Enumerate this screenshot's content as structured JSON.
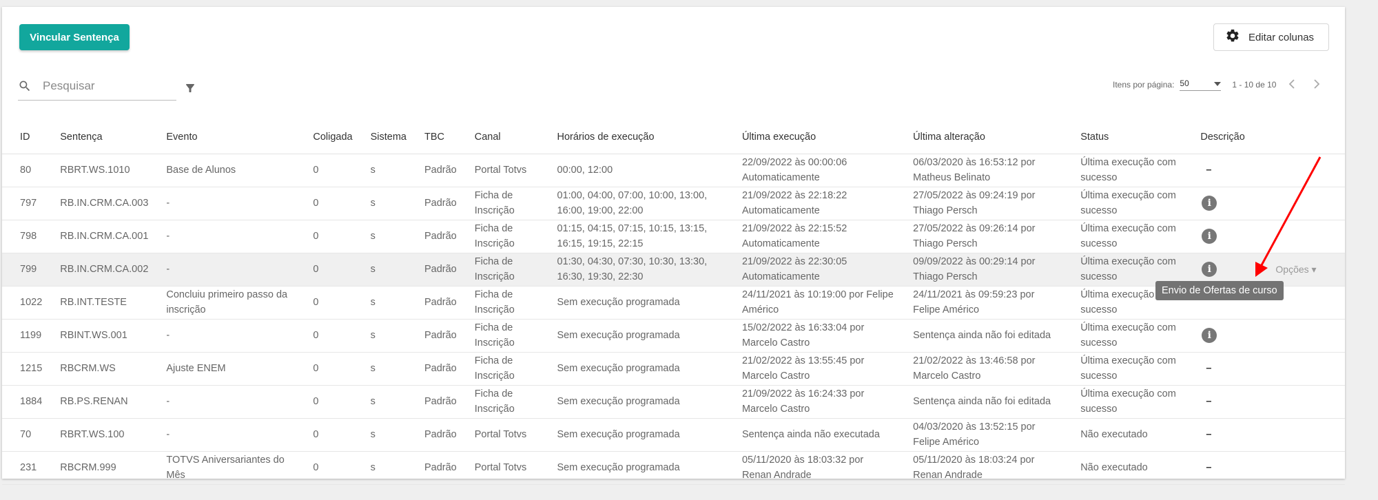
{
  "toolbar": {
    "primary_label": "Vincular Sentença",
    "columns_label": "Editar colunas"
  },
  "search": {
    "placeholder": "Pesquisar"
  },
  "pager": {
    "items_label": "Itens por página:",
    "items_value": "50",
    "range": "1 - 10 de 10"
  },
  "columns": [
    "ID",
    "Sentença",
    "Evento",
    "Coligada",
    "Sistema",
    "TBC",
    "Canal",
    "Horários de execução",
    "Última execução",
    "Última alteração",
    "Status",
    "Descrição"
  ],
  "rows": [
    {
      "id": "80",
      "sentenca": "RBRT.WS.1010",
      "evento": "Base de Alunos",
      "coligada": "0",
      "sistema": "s",
      "tbc": "Padrão",
      "canal": "Portal Totvs",
      "horarios": "00:00, 12:00",
      "ultima_execucao": "22/09/2022 às 00:00:06 Automaticamente",
      "ultima_alteracao": "06/03/2020 às 16:53:12 por Matheus Belinato",
      "status": "Última execução com sucesso",
      "descricao": "–"
    },
    {
      "id": "797",
      "sentenca": "RB.IN.CRM.CA.003",
      "evento": "-",
      "coligada": "0",
      "sistema": "s",
      "tbc": "Padrão",
      "canal": "Ficha de Inscrição",
      "horarios": "01:00, 04:00, 07:00, 10:00, 13:00, 16:00, 19:00, 22:00",
      "ultima_execucao": "21/09/2022 às 22:18:22 Automaticamente",
      "ultima_alteracao": "27/05/2022 às 09:24:19 por Thiago Persch",
      "status": "Última execução com sucesso",
      "descricao": "i"
    },
    {
      "id": "798",
      "sentenca": "RB.IN.CRM.CA.001",
      "evento": "-",
      "coligada": "0",
      "sistema": "s",
      "tbc": "Padrão",
      "canal": "Ficha de Inscrição",
      "horarios": "01:15, 04:15, 07:15, 10:15, 13:15, 16:15, 19:15, 22:15",
      "ultima_execucao": "21/09/2022 às 22:15:52 Automaticamente",
      "ultima_alteracao": "27/05/2022 às 09:26:14 por Thiago Persch",
      "status": "Última execução com sucesso",
      "descricao": "i"
    },
    {
      "id": "799",
      "sentenca": "RB.IN.CRM.CA.002",
      "evento": "-",
      "coligada": "0",
      "sistema": "s",
      "tbc": "Padrão",
      "canal": "Ficha de Inscrição",
      "horarios": "01:30, 04:30, 07:30, 10:30, 13:30, 16:30, 19:30, 22:30",
      "ultima_execucao": "21/09/2022 às 22:30:05 Automaticamente",
      "ultima_alteracao": "09/09/2022 às 00:29:14 por Thiago Persch",
      "status": "Última execução com sucesso",
      "descricao": "i",
      "opcoes": "Opções ▾"
    },
    {
      "id": "1022",
      "sentenca": "RB.INT.TESTE",
      "evento": "Concluiu primeiro passo da inscrição",
      "coligada": "0",
      "sistema": "s",
      "tbc": "Padrão",
      "canal": "Ficha de Inscrição",
      "horarios": "Sem execução programada",
      "ultima_execucao": "24/11/2021 às 10:19:00 por Felipe Américo",
      "ultima_alteracao": "24/11/2021 às 09:59:23 por Felipe Américo",
      "status": "Última execução com sucesso",
      "descricao": ""
    },
    {
      "id": "1199",
      "sentenca": "RBINT.WS.001",
      "evento": "-",
      "coligada": "0",
      "sistema": "s",
      "tbc": "Padrão",
      "canal": "Ficha de Inscrição",
      "horarios": "Sem execução programada",
      "ultima_execucao": "15/02/2022 às 16:33:04 por Marcelo Castro",
      "ultima_alteracao": "Sentença ainda não foi editada",
      "status": "Última execução com sucesso",
      "descricao": "i"
    },
    {
      "id": "1215",
      "sentenca": "RBCRM.WS",
      "evento": "Ajuste ENEM",
      "coligada": "0",
      "sistema": "s",
      "tbc": "Padrão",
      "canal": "Ficha de Inscrição",
      "horarios": "Sem execução programada",
      "ultima_execucao": "21/02/2022 às 13:55:45 por Marcelo Castro",
      "ultima_alteracao": "21/02/2022 às 13:46:58 por Marcelo Castro",
      "status": "Última execução com sucesso",
      "descricao": "–"
    },
    {
      "id": "1884",
      "sentenca": "RB.PS.RENAN",
      "evento": "-",
      "coligada": "0",
      "sistema": "s",
      "tbc": "Padrão",
      "canal": "Ficha de Inscrição",
      "horarios": "Sem execução programada",
      "ultima_execucao": "21/09/2022 às 16:24:33 por Marcelo Castro",
      "ultima_alteracao": "Sentença ainda não foi editada",
      "status": "Última execução com sucesso",
      "descricao": "–"
    },
    {
      "id": "70",
      "sentenca": "RBRT.WS.100",
      "evento": "-",
      "coligada": "0",
      "sistema": "s",
      "tbc": "Padrão",
      "canal": "Portal Totvs",
      "horarios": "Sem execução programada",
      "ultima_execucao": "Sentença ainda não executada",
      "ultima_alteracao": "04/03/2020 às 13:52:15 por Felipe Américo",
      "status": "Não executado",
      "descricao": "–"
    },
    {
      "id": "231",
      "sentenca": "RBCRM.999",
      "evento": "TOTVS Aniversariantes do Mês",
      "coligada": "0",
      "sistema": "s",
      "tbc": "Padrão",
      "canal": "Portal Totvs",
      "horarios": "Sem execução programada",
      "ultima_execucao": "05/11/2020 às 18:03:32 por Renan Andrade",
      "ultima_alteracao": "05/11/2020 às 18:03:24 por Renan Andrade",
      "status": "Não executado",
      "descricao": "–"
    }
  ],
  "tooltip": "Envio de Ofertas de curso",
  "colors": {
    "primary": "#12a79d",
    "arrow": "#ff0000",
    "tooltip_bg": "#737373"
  },
  "icons": [
    "search-icon",
    "filter-icon",
    "gear-icon",
    "chevron-left-icon",
    "chevron-right-icon",
    "dropdown-icon",
    "info-icon"
  ]
}
